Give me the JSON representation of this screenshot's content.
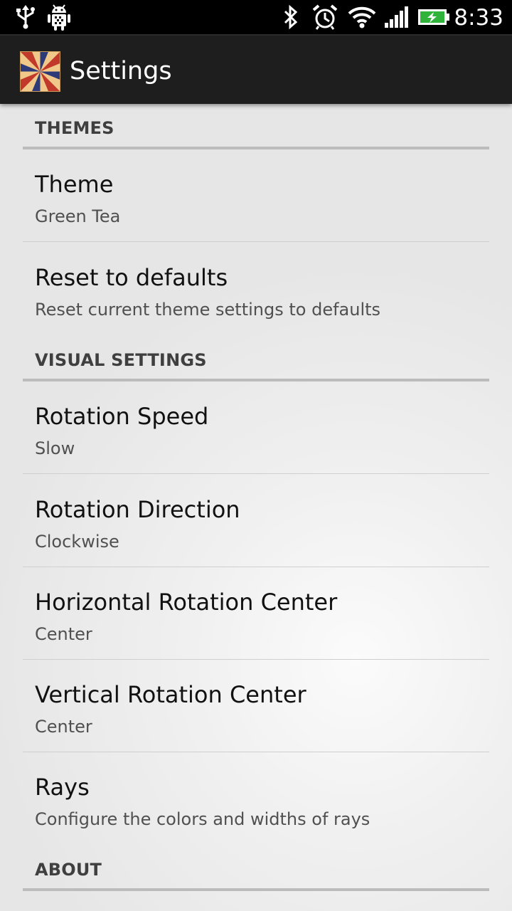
{
  "status_bar": {
    "time": "8:33",
    "icons": [
      "usb-icon",
      "android-debug-icon",
      "bluetooth-icon",
      "alarm-icon",
      "wifi-icon",
      "signal-icon",
      "battery-charging-icon"
    ],
    "battery_color": "#2fb33a"
  },
  "action_bar": {
    "title": "Settings",
    "app_icon": "sunburst-app-icon"
  },
  "sections": {
    "themes": {
      "label": "THEMES",
      "items": [
        {
          "title": "Theme",
          "summary": "Green Tea"
        },
        {
          "title": "Reset to defaults",
          "summary": "Reset current theme settings to defaults"
        }
      ]
    },
    "visual": {
      "label": "VISUAL SETTINGS",
      "items": [
        {
          "title": "Rotation Speed",
          "summary": "Slow"
        },
        {
          "title": "Rotation Direction",
          "summary": "Clockwise"
        },
        {
          "title": "Horizontal Rotation Center",
          "summary": "Center"
        },
        {
          "title": "Vertical Rotation Center",
          "summary": "Center"
        },
        {
          "title": "Rays",
          "summary": "Configure the colors and widths of rays"
        }
      ]
    },
    "about": {
      "label": "ABOUT"
    }
  },
  "colors": {
    "status_bar_bg": "#000000",
    "action_bar_bg": "#1e1e1e",
    "category_text": "#3f3f3f",
    "category_rule": "#bcbcbc",
    "title_text": "#111111",
    "summary_text": "#505050"
  }
}
